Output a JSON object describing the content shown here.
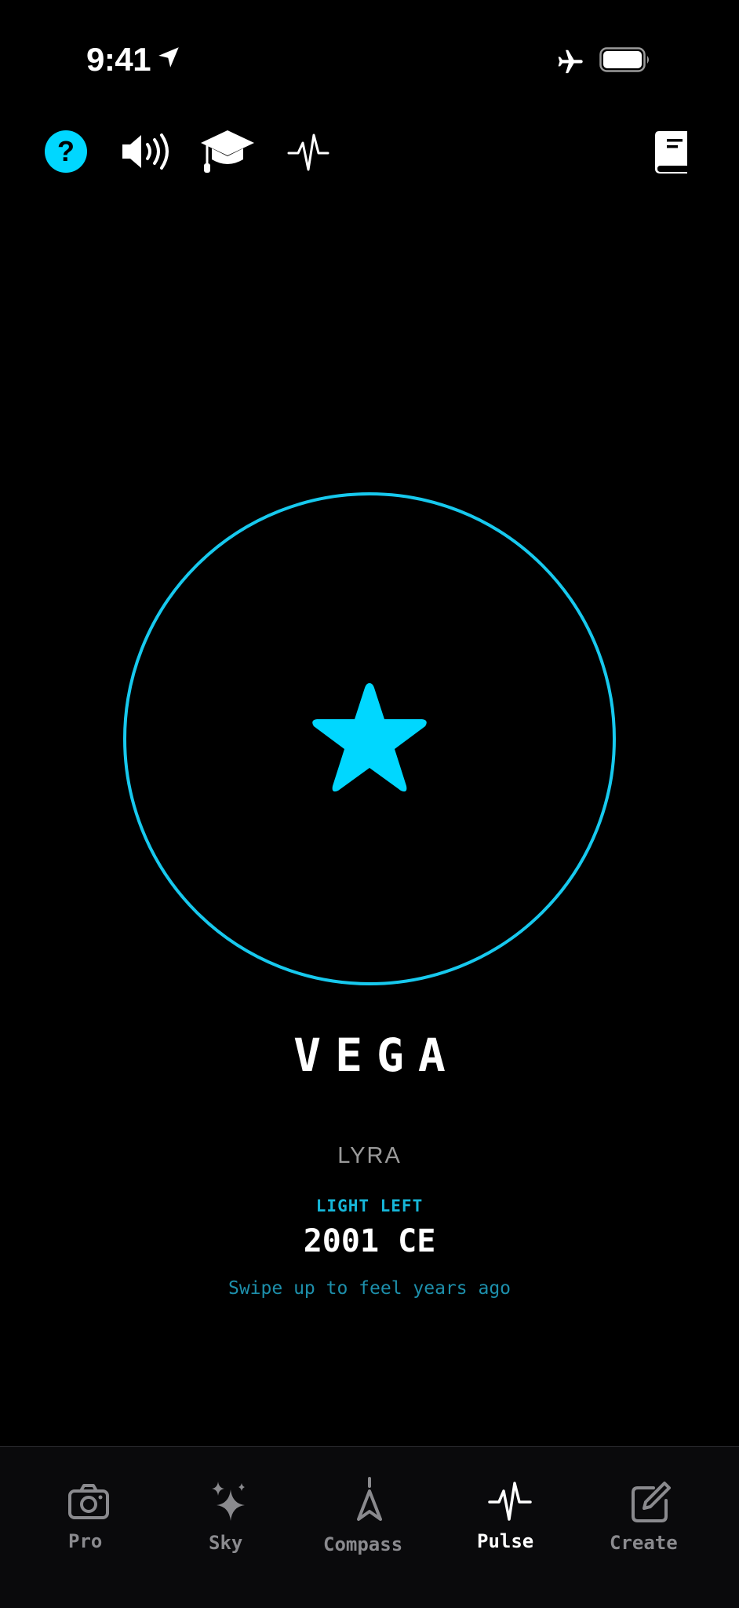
{
  "status_bar": {
    "time": "9:41",
    "icons": [
      "location-arrow-icon",
      "airplane-mode-icon",
      "battery-icon"
    ]
  },
  "toolbar": {
    "help_label": "?",
    "icons": [
      "help-icon",
      "speaker-icon",
      "graduation-cap-icon",
      "pulse-icon",
      "book-icon"
    ]
  },
  "colors": {
    "accent": "#00d7ff",
    "ring": "#17c9ee",
    "light_label": "#16b6d8",
    "hint": "#1d8fab",
    "tab_inactive": "#8a8a8e",
    "tab_active": "#ffffff"
  },
  "star": {
    "name": "VEGA",
    "constellation": "LYRA",
    "light_left_label": "LIGHT LEFT",
    "light_left_year": "2001 CE",
    "hint": "Swipe up to feel years ago"
  },
  "tabs": [
    {
      "label": "Pro",
      "icon": "camera-icon",
      "active": false
    },
    {
      "label": "Sky",
      "icon": "sparkles-icon",
      "active": false
    },
    {
      "label": "Compass",
      "icon": "compass-icon",
      "active": false
    },
    {
      "label": "Pulse",
      "icon": "pulse-icon",
      "active": true
    },
    {
      "label": "Create",
      "icon": "edit-icon",
      "active": false
    }
  ]
}
